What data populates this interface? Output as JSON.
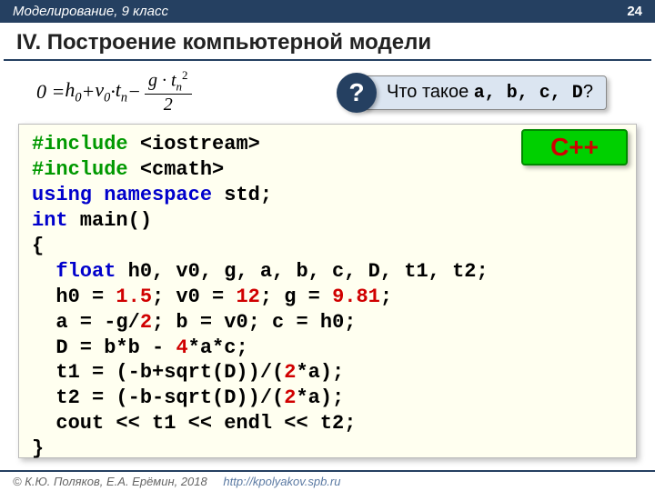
{
  "header": {
    "subject": "Моделирование, 9 класс",
    "page": "24"
  },
  "title": "IV. Построение компьютерной модели",
  "question": {
    "mark": "?",
    "lead": "Что такое ",
    "vars": "a, b, c, D",
    "tail": "?"
  },
  "badge": "С++",
  "code": {
    "l1a": "#include",
    "l1b": " <iostream>",
    "l2a": "#include",
    "l2b": " <cmath>",
    "l3a": "using namespace",
    "l3b": " std;",
    "l4a": "int",
    "l4b": " main()",
    "l5": "{",
    "l6a": "  ",
    "l6b": "float",
    "l6c": " h0, v0, g, a, b, c, D, t1, t2;",
    "l7a": "  h0 = ",
    "l7b": "1.5",
    "l7c": "; v0 = ",
    "l7d": "12",
    "l7e": "; g = ",
    "l7f": "9.81",
    "l7g": ";",
    "l8a": "  a = -g/",
    "l8b": "2",
    "l8c": "; b = v0; c = h0;",
    "l9a": "  D = b*b - ",
    "l9b": "4",
    "l9c": "*a*c;",
    "l10a": "  t1 = (-b+sqrt(D))/(",
    "l10b": "2",
    "l10c": "*a);",
    "l11a": "  t2 = (-b-sqrt(D))/(",
    "l11b": "2",
    "l11c": "*a);",
    "l12": "  cout << t1 << endl << t2;",
    "l13": "}"
  },
  "footer": {
    "copyright": "© К.Ю. Поляков, Е.А. Ерёмин, 2018",
    "link": "http://kpolyakov.spb.ru"
  },
  "formula": {
    "eq": "0 = ",
    "h0": "h",
    "h0sub": "0",
    "plus1": " + ",
    "v0": "v",
    "v0sub": "0",
    "dot1": " · ",
    "tn": "t",
    "tnsub": "n",
    "minus": " − ",
    "num_g": "g · t",
    "num_sub": "n",
    "num_sup": "2",
    "den": "2"
  }
}
